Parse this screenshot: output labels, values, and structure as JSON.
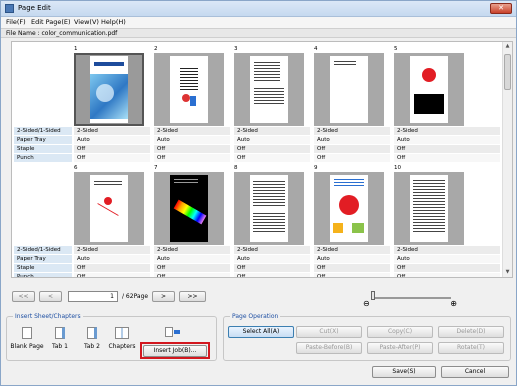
{
  "window": {
    "title": "Page Edit",
    "close": "✕"
  },
  "menu": [
    "File(F)",
    "Edit Page(E)",
    "View(V)",
    "Help(H)"
  ],
  "file": {
    "label": "File Name : color_communication.pdf"
  },
  "rows": [
    {
      "labels": [
        "2-Sided/1-Sided",
        "Paper Tray",
        "Staple",
        "Punch"
      ],
      "pages": [
        {
          "num": "1",
          "values": [
            "2-Sided",
            "Auto",
            "Off",
            "Off"
          ]
        },
        {
          "num": "2",
          "values": [
            "2-Sided",
            "Auto",
            "Off",
            "Off"
          ]
        },
        {
          "num": "3",
          "values": [
            "2-Sided",
            "Auto",
            "Off",
            "Off"
          ]
        },
        {
          "num": "4",
          "values": [
            "2-Sided",
            "Auto",
            "Off",
            "Off"
          ]
        },
        {
          "num": "5",
          "values": [
            "2-Sided",
            "Auto",
            "Off",
            "Off"
          ]
        }
      ]
    },
    {
      "labels": [
        "2-Sided/1-Sided",
        "Paper Tray",
        "Staple",
        "Punch"
      ],
      "pages": [
        {
          "num": "6",
          "values": [
            "2-Sided",
            "Auto",
            "Off",
            "Off"
          ]
        },
        {
          "num": "7",
          "values": [
            "2-Sided",
            "Auto",
            "Off",
            "Off"
          ]
        },
        {
          "num": "8",
          "values": [
            "2-Sided",
            "Auto",
            "Off",
            "Off"
          ]
        },
        {
          "num": "9",
          "values": [
            "2-Sided",
            "Auto",
            "Off",
            "Off"
          ]
        },
        {
          "num": "10",
          "values": [
            "2-Sided",
            "Auto",
            "Off",
            "Off"
          ]
        }
      ]
    }
  ],
  "nav": {
    "first": "<<",
    "prev": "<",
    "page": "1",
    "total": "/ 62Page",
    "next": ">",
    "last": ">>"
  },
  "insert": {
    "title": "Insert Sheet/Chapters",
    "items": [
      "Blank Page",
      "Tab 1",
      "Tab 2",
      "Chapters"
    ],
    "insert_job": "Insert Job(B)..."
  },
  "operation": {
    "title": "Page Operation",
    "select_all": "Select All(A)",
    "cut": "Cut(X)",
    "copy": "Copy(C)",
    "delete": "Delete(D)",
    "paste_before": "Paste-Before(B)",
    "paste_after": "Paste-After(P)",
    "rotate": "Rotate(T)"
  },
  "footer": {
    "save": "Save(S)",
    "cancel": "Cancel"
  },
  "colors": {
    "accent": "#1e4fa2",
    "highlight": "#d2161e"
  }
}
